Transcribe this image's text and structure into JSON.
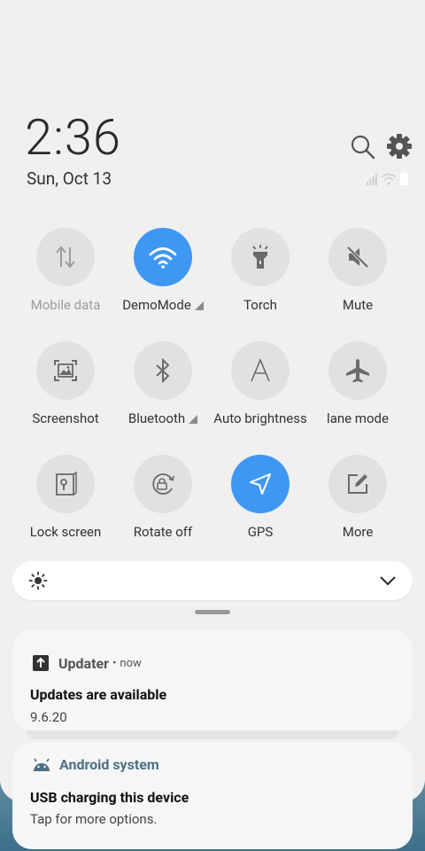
{
  "header": {
    "time": "2:36",
    "date": "Sun, Oct 13"
  },
  "tiles": [
    {
      "label": "Mobile data",
      "icon": "mobile-data-icon",
      "active": false
    },
    {
      "label": "DemoMode",
      "icon": "wifi-icon",
      "active": true
    },
    {
      "label": "Torch",
      "icon": "torch-icon",
      "active": false
    },
    {
      "label": "Mute",
      "icon": "mute-icon",
      "active": false
    },
    {
      "label": "Screenshot",
      "icon": "screenshot-icon",
      "active": false
    },
    {
      "label": "Bluetooth",
      "icon": "bluetooth-icon",
      "active": false
    },
    {
      "label": "Auto brightness",
      "icon": "auto-brightness-icon",
      "active": false
    },
    {
      "label": "lane mode",
      "icon": "airplane-icon",
      "active": false
    },
    {
      "label": "Lock screen",
      "icon": "lock-screen-icon",
      "active": false
    },
    {
      "label": "Rotate off",
      "icon": "rotate-icon",
      "active": false
    },
    {
      "label": "GPS",
      "icon": "gps-icon",
      "active": true
    },
    {
      "label": "More",
      "icon": "edit-icon",
      "active": false
    }
  ],
  "colors": {
    "accent": "#3f97f4",
    "tile_bg": "#e1e1e3"
  },
  "notifications": [
    {
      "app": "Updater",
      "time": "now",
      "title": "Updates are available",
      "body": "9.6.20",
      "dot": "•"
    },
    {
      "app": "Android system",
      "title": "USB charging this device",
      "body": "Tap for more options."
    }
  ]
}
